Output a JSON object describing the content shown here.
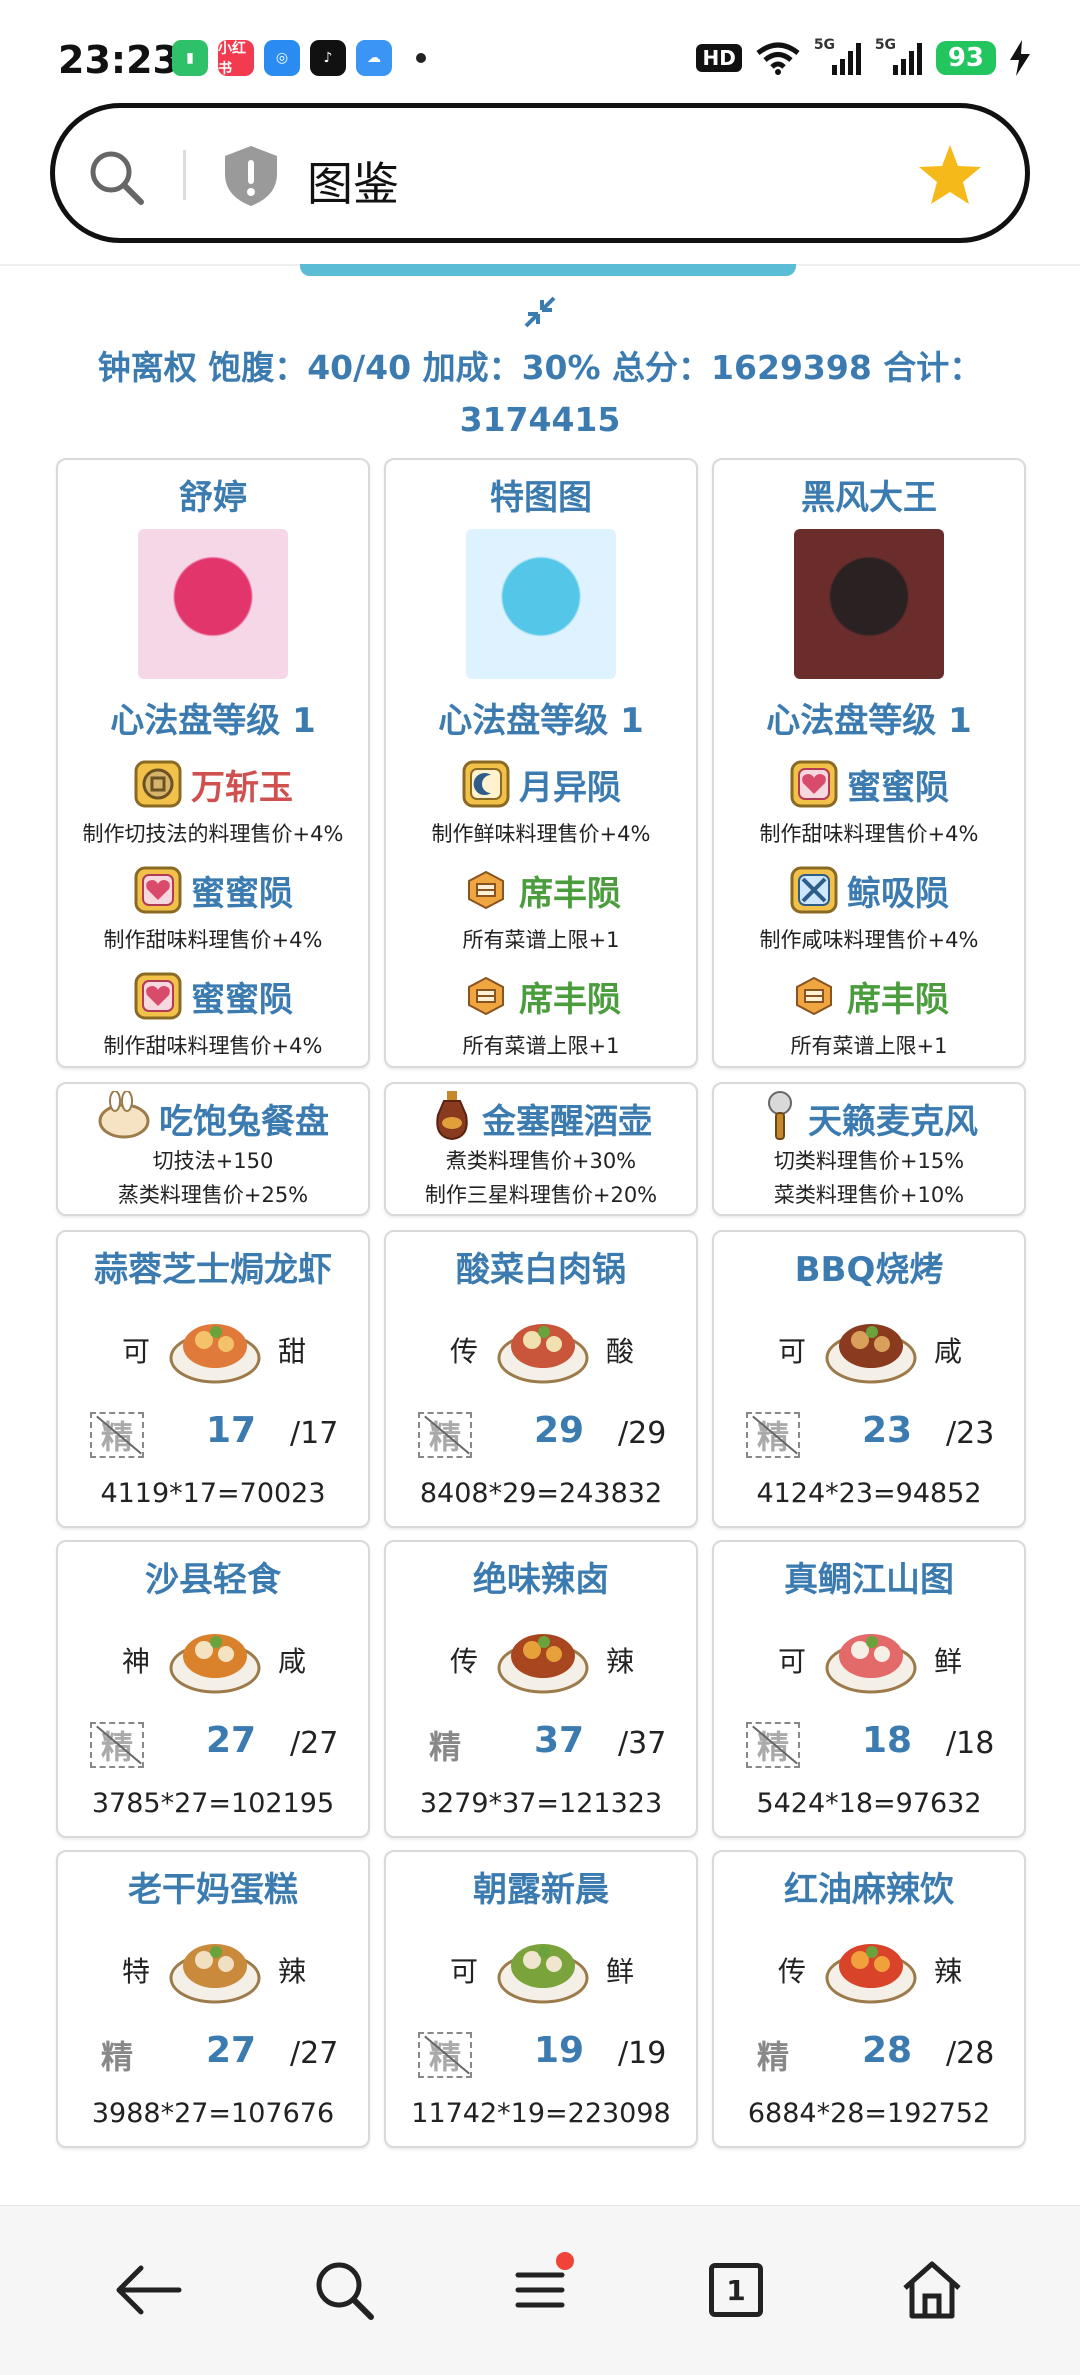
{
  "status_bar": {
    "time": "23:23",
    "apps": [
      {
        "name": "battery-app-icon",
        "color": "#2fc06a",
        "text": "▮"
      },
      {
        "name": "xiaohongshu-app-icon",
        "color": "#f23b4f",
        "text": "小红书"
      },
      {
        "name": "baidu-app-icon",
        "color": "#2a8cf0",
        "text": "◎"
      },
      {
        "name": "tiktok-app-icon",
        "color": "#111111",
        "text": "♪"
      },
      {
        "name": "weather-app-icon",
        "color": "#3a95f5",
        "text": "☁"
      }
    ],
    "hd": "HD",
    "network_1": "5G",
    "network_2": "5G",
    "battery": "93"
  },
  "address_bar": {
    "title": "图鉴"
  },
  "summary": "钟离权 饱腹：40/40 加成：30% 总分：1629398 合计：3174415",
  "chefs": [
    {
      "name": "舒婷",
      "level": "心法盘等级 1",
      "portrait_colors": [
        "#f6d7e8",
        "#e2356b"
      ],
      "runes": [
        {
          "name": "万斩玉",
          "icon": "coin-rune-icon",
          "color": "#d05050",
          "desc": "制作切技法的料理售价+4%"
        },
        {
          "name": "蜜蜜陨",
          "icon": "heart-rune-icon",
          "color": "#3b7bb0",
          "desc": "制作甜味料理售价+4%"
        },
        {
          "name": "蜜蜜陨",
          "icon": "heart-rune-icon",
          "color": "#3b7bb0",
          "desc": "制作甜味料理售价+4%"
        }
      ]
    },
    {
      "name": "特图图",
      "level": "心法盘等级 1",
      "portrait_colors": [
        "#dff2ff",
        "#54c7e8"
      ],
      "runes": [
        {
          "name": "月异陨",
          "icon": "moon-rune-icon",
          "color": "#3b7bb0",
          "desc": "制作鲜味料理售价+4%"
        },
        {
          "name": "席丰陨",
          "icon": "feast-rune-icon",
          "color": "#4a9c3c",
          "desc": "所有菜谱上限+1"
        },
        {
          "name": "席丰陨",
          "icon": "feast-rune-icon",
          "color": "#4a9c3c",
          "desc": "所有菜谱上限+1"
        }
      ]
    },
    {
      "name": "黑风大王",
      "level": "心法盘等级 1",
      "portrait_colors": [
        "#6b2c2c",
        "#2a2222"
      ],
      "runes": [
        {
          "name": "蜜蜜陨",
          "icon": "heart-rune-icon",
          "color": "#3b7bb0",
          "desc": "制作甜味料理售价+4%"
        },
        {
          "name": "鲸吸陨",
          "icon": "whale-rune-icon",
          "color": "#3b7bb0",
          "desc": "制作咸味料理售价+4%"
        },
        {
          "name": "席丰陨",
          "icon": "feast-rune-icon",
          "color": "#4a9c3c",
          "desc": "所有菜谱上限+1"
        }
      ]
    }
  ],
  "equipment": [
    {
      "name": "吃饱兔餐盘",
      "icon": "rabbit-plate-icon",
      "lines": [
        "切技法+150",
        "蒸类料理售价+25%"
      ]
    },
    {
      "name": "金塞醒酒壶",
      "icon": "wine-jug-icon",
      "lines": [
        "煮类料理售价+30%",
        "制作三星料理售价+20%"
      ]
    },
    {
      "name": "天籁麦克风",
      "icon": "microphone-icon",
      "lines": [
        "切类料理售价+15%",
        "菜类料理售价+10%"
      ]
    }
  ],
  "dishes": [
    {
      "name": "蒜蓉芝士焗龙虾",
      "g1": "可",
      "g2": "甜",
      "jing": "精",
      "jing_boxed": true,
      "count": "17",
      "max": "/17",
      "formula": "4119*17=70023",
      "colors": [
        "#e07a3a",
        "#f3c26b"
      ]
    },
    {
      "name": "酸菜白肉锅",
      "g1": "传",
      "g2": "酸",
      "jing": "精",
      "jing_boxed": true,
      "count": "29",
      "max": "/29",
      "formula": "8408*29=243832",
      "colors": [
        "#c9553a",
        "#f1e1b0"
      ]
    },
    {
      "name": "BBQ烧烤",
      "g1": "可",
      "g2": "咸",
      "jing": "精",
      "jing_boxed": true,
      "count": "23",
      "max": "/23",
      "formula": "4124*23=94852",
      "colors": [
        "#8a3b1f",
        "#d9a05b"
      ]
    },
    {
      "name": "沙县轻食",
      "g1": "神",
      "g2": "咸",
      "jing": "精",
      "jing_boxed": true,
      "count": "27",
      "max": "/27",
      "formula": "3785*27=102195",
      "colors": [
        "#d9822b",
        "#f4e3c1"
      ]
    },
    {
      "name": "绝味辣卤",
      "g1": "传",
      "g2": "辣",
      "jing": "精",
      "jing_boxed": false,
      "count": "37",
      "max": "/37",
      "formula": "3279*37=121323",
      "colors": [
        "#a8471f",
        "#e6a13b"
      ]
    },
    {
      "name": "真鲷江山图",
      "g1": "可",
      "g2": "鲜",
      "jing": "精",
      "jing_boxed": true,
      "count": "18",
      "max": "/18",
      "formula": "5424*18=97632",
      "colors": [
        "#e46a6a",
        "#f6efe6"
      ]
    },
    {
      "name": "老干妈蛋糕",
      "g1": "特",
      "g2": "辣",
      "jing": "精",
      "jing_boxed": false,
      "count": "27",
      "max": "/27",
      "formula": "3988*27=107676",
      "colors": [
        "#c98a3b",
        "#f1dfc1"
      ]
    },
    {
      "name": "朝露新晨",
      "g1": "可",
      "g2": "鲜",
      "jing": "精",
      "jing_boxed": true,
      "count": "19",
      "max": "/19",
      "formula": "11742*19=223098",
      "colors": [
        "#7aa33b",
        "#f0e6cf"
      ]
    },
    {
      "name": "红油麻辣饮",
      "g1": "传",
      "g2": "辣",
      "jing": "精",
      "jing_boxed": false,
      "count": "28",
      "max": "/28",
      "formula": "6884*28=192752",
      "colors": [
        "#d9432a",
        "#f2a03c"
      ]
    }
  ],
  "bottom_nav": {
    "tab_count": "1"
  }
}
